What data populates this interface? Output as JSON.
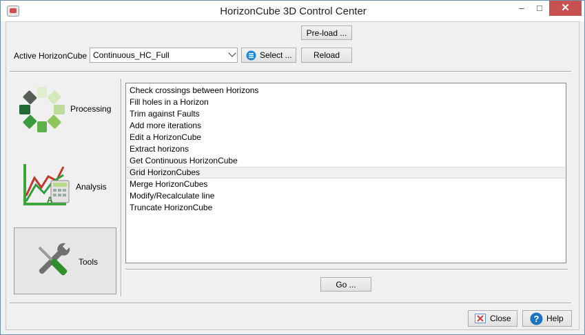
{
  "window": {
    "title": "HorizonCube 3D Control Center",
    "minimize_glyph": "–",
    "maximize_glyph": "□",
    "close_glyph": "✕"
  },
  "toolbar": {
    "preload_label": "Pre-load ...",
    "active_label": "Active HorizonCube",
    "active_value": "Continuous_HC_Full",
    "select_label": "Select ...",
    "reload_label": "Reload"
  },
  "sidebar": {
    "items": [
      {
        "label": "Processing",
        "icon": "processing-icon"
      },
      {
        "label": "Analysis",
        "icon": "analysis-icon"
      },
      {
        "label": "Tools",
        "icon": "tools-icon",
        "selected": true
      }
    ]
  },
  "tools_list": {
    "items": [
      "Check crossings between Horizons",
      "Fill holes in a Horizon",
      "Trim against Faults",
      "Add more iterations",
      "Edit a HorizonCube",
      "Extract horizons",
      "Get Continuous HorizonCube",
      "Grid HorizonCubes",
      "Merge HorizonCubes",
      "Modify/Recalculate line",
      "Truncate HorizonCube"
    ],
    "selected_item": "Grid HorizonCubes"
  },
  "go_label": "Go ...",
  "footer": {
    "close_label": "Close",
    "help_label": "Help"
  },
  "colors": {
    "accent_blue": "#1e73be",
    "close_red": "#c75050",
    "green_dark": "#2e7d32",
    "green_light": "#8bc34a"
  }
}
